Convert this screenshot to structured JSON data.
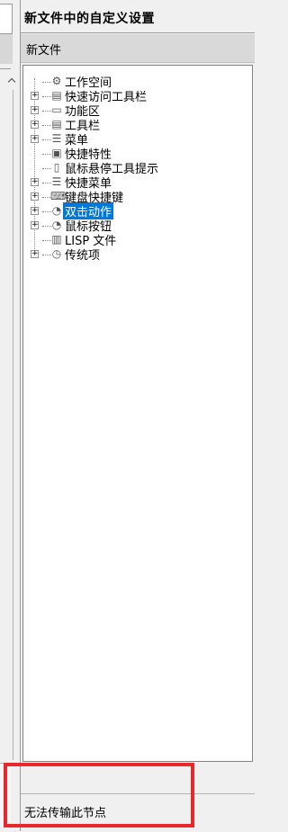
{
  "panel": {
    "title": "新文件中的自定义设置",
    "subheader": "新文件"
  },
  "tree": {
    "items": [
      {
        "label": "工作空间",
        "icon": "gear-icon",
        "expandable": false
      },
      {
        "label": "快速访问工具栏",
        "icon": "toolbar-icon",
        "expandable": true
      },
      {
        "label": "功能区",
        "icon": "folder-icon",
        "expandable": true
      },
      {
        "label": "工具栏",
        "icon": "toolbar-icon",
        "expandable": true
      },
      {
        "label": "菜单",
        "icon": "menu-icon",
        "expandable": true
      },
      {
        "label": "快捷特性",
        "icon": "properties-icon",
        "expandable": false
      },
      {
        "label": "鼠标悬停工具提示",
        "icon": "tooltip-icon",
        "expandable": false
      },
      {
        "label": "快捷菜单",
        "icon": "menu-icon",
        "expandable": true
      },
      {
        "label": "键盘快捷键",
        "icon": "keyboard-icon",
        "expandable": true
      },
      {
        "label": "双击动作",
        "icon": "mouse-icon",
        "expandable": true,
        "selected": true
      },
      {
        "label": "鼠标按钮",
        "icon": "mouse-icon",
        "expandable": true
      },
      {
        "label": "LISP 文件",
        "icon": "file-icon",
        "expandable": false
      },
      {
        "label": "传统项",
        "icon": "clock-icon",
        "expandable": true
      }
    ]
  },
  "status": {
    "text": "无法传输此节点"
  },
  "colors": {
    "selection": "#0078d7",
    "highlight_border": "#e8282b"
  }
}
